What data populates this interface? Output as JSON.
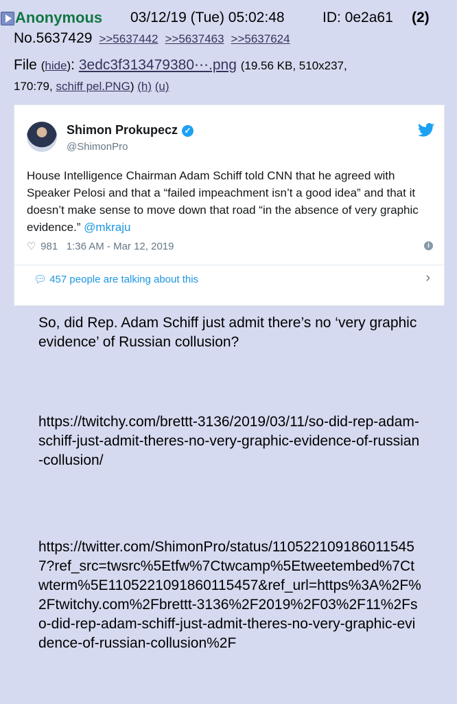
{
  "post": {
    "name": "Anonymous",
    "date": "03/12/19 (Tue) 05:02:48",
    "id_label": "ID: 0e2a61",
    "reply_count": "(2)",
    "number": "No.5637429",
    "backlinks": [
      ">>5637442",
      ">>5637463",
      ">>5637624"
    ],
    "file_label": "File",
    "hide_label": "hide",
    "file_name": "3edc3f313479380⋯.png",
    "file_info": "(19.56 KB, 510x237,",
    "file_ratio": "170:79,",
    "file_orig": "schiff pel.PNG",
    "h_link": "(h)",
    "u_link": "(u)"
  },
  "tweet": {
    "author": "Shimon Prokupecz",
    "handle": "@ShimonPro",
    "text": "House Intelligence Chairman Adam Schiff told CNN that he agreed with Speaker Pelosi and that a “failed impeachment isn’t a good idea” and that it doesn’t make sense to move down that road “in the absence of very graphic evidence.”",
    "mention": "@mkraju",
    "likes": "981",
    "timestamp": "1:36 AM - Mar 12, 2019",
    "talking": "457 people are talking about this",
    "colors": {
      "link": "#1b95e0",
      "verified": "#1da1f2"
    }
  },
  "message": {
    "p1": "So, did Rep. Adam Schiff just admit there’s no ‘very graphic evidence’ of Russian collusion?",
    "p2": "https://twitchy.com/brettt-3136/2019/03/11/so-did-rep-adam-schiff-just-admit-theres-no-very-graphic-evidence-of-russian-collusion/",
    "p3": "https://twitter.com/ShimonPro/status/1105221091860115457?ref_src=twsrc%5Etfw%7Ctwcamp%5Etweetembed%7Ctwterm%5E1105221091860115457&ref_url=https%3A%2F%2Ftwitchy.com%2Fbrettt-3136%2F2019%2F03%2F11%2Fso-did-rep-adam-schiff-just-admit-theres-no-very-graphic-evidence-of-russian-collusion%2F"
  }
}
